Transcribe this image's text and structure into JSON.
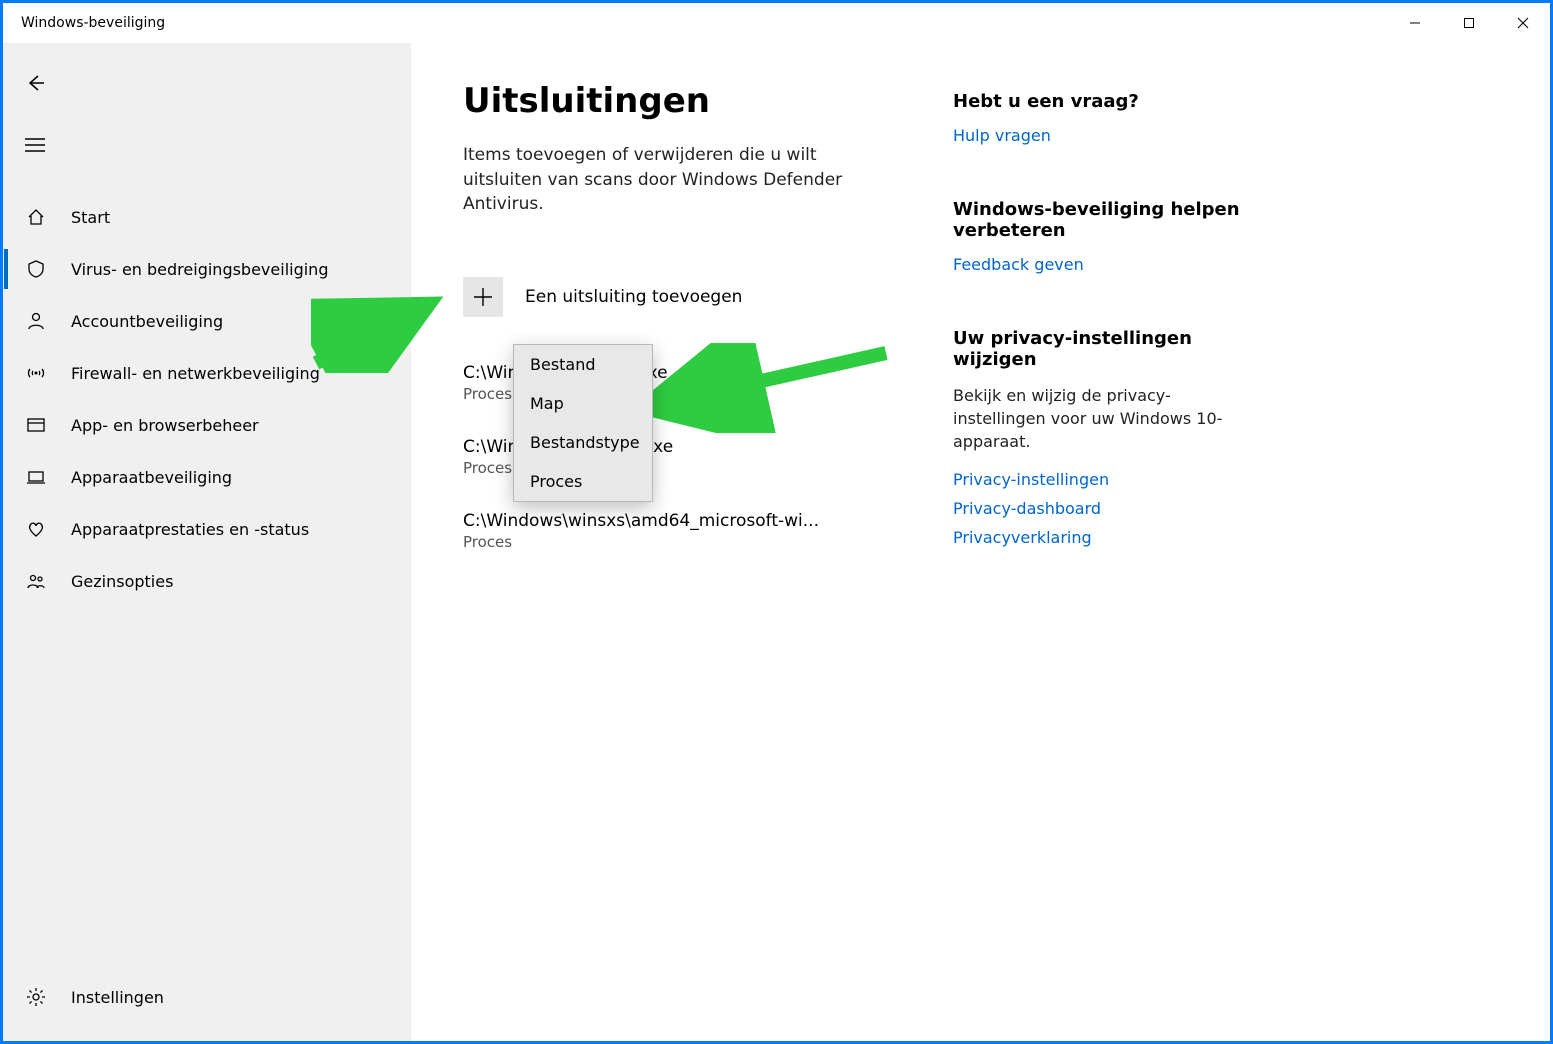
{
  "window": {
    "title": "Windows-beveiliging"
  },
  "sidebar": {
    "items": [
      {
        "key": "start",
        "label": "Start"
      },
      {
        "key": "virus",
        "label": "Virus- en bedreigingsbeveiliging",
        "active": true
      },
      {
        "key": "account",
        "label": "Accountbeveiliging"
      },
      {
        "key": "firewall",
        "label": "Firewall- en netwerkbeveiliging"
      },
      {
        "key": "appbrowser",
        "label": "App- en browserbeheer"
      },
      {
        "key": "device",
        "label": "Apparaatbeveiliging"
      },
      {
        "key": "perf",
        "label": "Apparaatprestaties en -status"
      },
      {
        "key": "family",
        "label": "Gezinsopties"
      }
    ],
    "settings_label": "Instellingen"
  },
  "page": {
    "title": "Uitsluitingen",
    "description": "Items toevoegen of verwijderen die u wilt uitsluiten van scans door Windows Defender Antivirus.",
    "add_label": "Een uitsluiting toevoegen",
    "exclusions": [
      {
        "path": "C:\\Windows\\...\\...ost.exe",
        "type": "Proces"
      },
      {
        "path": "C:\\Windows\\...\\...nclt.exe",
        "type": "Proces"
      },
      {
        "path": "C:\\Windows\\winsxs\\amd64_microsoft-wi...",
        "type": "Proces"
      }
    ],
    "dropdown": [
      "Bestand",
      "Map",
      "Bestandstype",
      "Proces"
    ]
  },
  "aside": {
    "help": {
      "title": "Hebt u een vraag?",
      "link": "Hulp vragen"
    },
    "feedback": {
      "title": "Windows-beveiliging helpen verbeteren",
      "link": "Feedback geven"
    },
    "privacy": {
      "title": "Uw privacy-instellingen wijzigen",
      "text": "Bekijk en wijzig de privacy-instellingen voor uw Windows 10-apparaat.",
      "links": [
        "Privacy-instellingen",
        "Privacy-dashboard",
        "Privacyverklaring"
      ]
    }
  }
}
